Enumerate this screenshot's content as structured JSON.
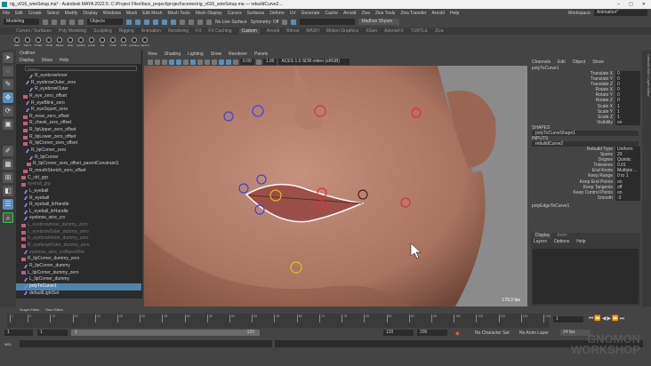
{
  "title": "rig_v016_wireSetup.ma* - Autodesk MAYA 2022.5: C:\\Project Files\\face_project\\project\\scenes\\rig_v016_wireSetup.ma --- rebuildCurve2...",
  "window_controls": [
    "–",
    "▢",
    "✕"
  ],
  "menubar": [
    "File",
    "Edit",
    "Create",
    "Select",
    "Modify",
    "Display",
    "Windows",
    "Mesh",
    "Edit Mesh",
    "Mesh Tools",
    "Mesh Display",
    "Curves",
    "Surfaces",
    "Deform",
    "UV",
    "Generate",
    "Cache",
    "Arnold",
    "Ziva",
    "Ziva Tools",
    "Ziva Transfer",
    "Arnold",
    "Help"
  ],
  "workspace": {
    "label": "Workspace:",
    "value": "Animation*"
  },
  "status": {
    "mode": "Modeling",
    "objects": "Objects",
    "live": "No Live Surface",
    "symmetry": "Symmetry: Off",
    "user": "Madhav Shyam"
  },
  "shelf_tabs": [
    "Curves / Surfaces",
    "Poly Modeling",
    "Sculpting",
    "Rigging",
    "Animation",
    "Rendering",
    "FX",
    "FX Caching",
    "Custom",
    "Arnold",
    "Bifrost",
    "MASH",
    "Motion Graphics",
    "XGen",
    "AdonisFX",
    "TURTLE",
    "Ziva"
  ],
  "shelf_active": "Custom",
  "shelf_buttons": [
    "zMirr",
    "zMirrX",
    "zTGDn",
    "zTGR",
    "zBasis",
    "pFlip",
    "parFlip",
    "pnFlip",
    "CE",
    "CVW",
    "PVW",
    "parSkeg",
    "depUnr"
  ],
  "outliner": {
    "title": "Outliner",
    "menus": [
      "Display",
      "Show",
      "Help"
    ],
    "search_placeholder": "Search...",
    "rows": [
      {
        "label": "R_eyebrowInner",
        "type": "joint",
        "dim": false
      },
      {
        "label": "R_eyebrowOuter_zero",
        "type": "joint",
        "dim": false
      },
      {
        "label": "R_eyebrowOuter",
        "type": "joint",
        "dim": false
      },
      {
        "label": "R_eye_zero_offset",
        "type": "group",
        "dim": false
      },
      {
        "label": "R_eyeBlink_zero",
        "type": "joint",
        "dim": false
      },
      {
        "label": "R_eyeSquint_zero",
        "type": "joint",
        "dim": false
      },
      {
        "label": "R_nose_zero_offset",
        "type": "group",
        "dim": false
      },
      {
        "label": "R_cheek_zero_offset",
        "type": "group",
        "dim": false
      },
      {
        "label": "R_lipUpper_zero_offset",
        "type": "group",
        "dim": false
      },
      {
        "label": "R_lipLower_zero_offset",
        "type": "group",
        "dim": false
      },
      {
        "label": "R_lipCorner_zero_offset",
        "type": "group",
        "dim": false
      },
      {
        "label": "R_lipCorner_zero",
        "type": "joint",
        "dim": false
      },
      {
        "label": "R_lipCorner",
        "type": "joint",
        "dim": false
      },
      {
        "label": "R_lipCorner_zero_offset_parentConstraint1",
        "type": "group",
        "dim": false
      },
      {
        "label": "R_mouthStretch_zero_offset",
        "type": "group",
        "dim": false
      },
      {
        "label": "C_ctrl_grp",
        "type": "group",
        "dim": false
      },
      {
        "label": "eyeball_grp",
        "type": "group",
        "dim": true
      },
      {
        "label": "L_eyeball",
        "type": "joint",
        "dim": false
      },
      {
        "label": "R_eyeball",
        "type": "joint",
        "dim": false
      },
      {
        "label": "R_eyeball_ikHandle",
        "type": "joint",
        "dim": false
      },
      {
        "label": "L_eyeball_ikHandle",
        "type": "joint",
        "dim": false
      },
      {
        "label": "eyebrow_wire_crv",
        "type": "joint",
        "dim": false
      },
      {
        "label": "L_eyebrowInner_dummy_zero",
        "type": "group",
        "dim": true
      },
      {
        "label": "L_eyebrowOuter_dummy_zero",
        "type": "group",
        "dim": true
      },
      {
        "label": "R_eyebrowInner_dummy_zero",
        "type": "group",
        "dim": true
      },
      {
        "label": "R_eyebrowOuter_dummy_zero",
        "type": "group",
        "dim": true
      },
      {
        "label": "eyebrow_wire_crvBaseWire",
        "type": "joint",
        "dim": true
      },
      {
        "label": "R_lipCorner_dummy_zero",
        "type": "group",
        "dim": false
      },
      {
        "label": "R_lipCorner_dummy",
        "type": "joint",
        "dim": false
      },
      {
        "label": "L_lipCorner_dummy_zero",
        "type": "group",
        "dim": false
      },
      {
        "label": "L_lipCorner_dummy",
        "type": "joint",
        "dim": false
      },
      {
        "label": "polyToCurve1",
        "type": "joint",
        "dim": false,
        "selected": true
      },
      {
        "label": "defaultLightSet",
        "type": "joint",
        "dim": false
      }
    ]
  },
  "viewport": {
    "menus": [
      "View",
      "Shading",
      "Lighting",
      "Show",
      "Renderer",
      "Panels"
    ],
    "exposure": "0.00",
    "gamma": "1.00",
    "colorspace": "ACES 1.0 SDR-video (sRGB)",
    "fps": "179.3 fps"
  },
  "channel_box": {
    "menus": [
      "Channels",
      "Edit",
      "Object",
      "Show"
    ],
    "node": "polyToCurve1",
    "channels": [
      {
        "name": "Translate X",
        "value": "0"
      },
      {
        "name": "Translate Y",
        "value": "0"
      },
      {
        "name": "Translate Z",
        "value": "0"
      },
      {
        "name": "Rotate X",
        "value": "0"
      },
      {
        "name": "Rotate Y",
        "value": "0"
      },
      {
        "name": "Rotate Z",
        "value": "0"
      },
      {
        "name": "Scale X",
        "value": "1"
      },
      {
        "name": "Scale Y",
        "value": "1"
      },
      {
        "name": "Scale Z",
        "value": "1"
      },
      {
        "name": "Visibility",
        "value": "on"
      }
    ],
    "shapes_label": "SHAPES",
    "shape": "polyToCurveShape1",
    "inputs_label": "INPUTS",
    "input": "rebuildCurve2",
    "inputs": [
      {
        "name": "Rebuild Type",
        "value": "Uniform"
      },
      {
        "name": "Spans",
        "value": "20"
      },
      {
        "name": "Degree",
        "value": "Quintic"
      },
      {
        "name": "Tolerance",
        "value": "0.01"
      },
      {
        "name": "End Knots",
        "value": "Multiple ..."
      },
      {
        "name": "Keep Range",
        "value": "0 to 1"
      },
      {
        "name": "Keep End Points",
        "value": "on"
      },
      {
        "name": "Keep Tangents",
        "value": "off"
      },
      {
        "name": "Keep Control Points",
        "value": "on"
      },
      {
        "name": "Smooth",
        "value": "-3"
      }
    ],
    "input2": "polyEdgeToCurve1",
    "side_tab": "Channel Box / Layer Editor"
  },
  "layer_editor": {
    "tabs": [
      "Display",
      "Anim"
    ],
    "menus": [
      "Layers",
      "Options",
      "Help"
    ]
  },
  "bottom_tabs": [
    "Graph Editor",
    "Time Editor"
  ],
  "timeline": {
    "ticks": [
      "1",
      "5",
      "10",
      "15",
      "20",
      "25",
      "30",
      "35",
      "40",
      "45",
      "50",
      "55",
      "60",
      "65",
      "70",
      "75",
      "80",
      "85",
      "90",
      "95",
      "100",
      "105",
      "110",
      "115",
      "120"
    ],
    "current_frame": "1"
  },
  "range": {
    "start": "1",
    "inner_start": "1",
    "slider_start": "1",
    "slider_end": "120",
    "end": "120",
    "max": "200",
    "character_set": "No Character Set",
    "anim_layer": "No Anim Layer",
    "fps": "24 fps"
  },
  "command": {
    "label": "MEL"
  },
  "watermark": "THE GNOMON WORKSHOP"
}
